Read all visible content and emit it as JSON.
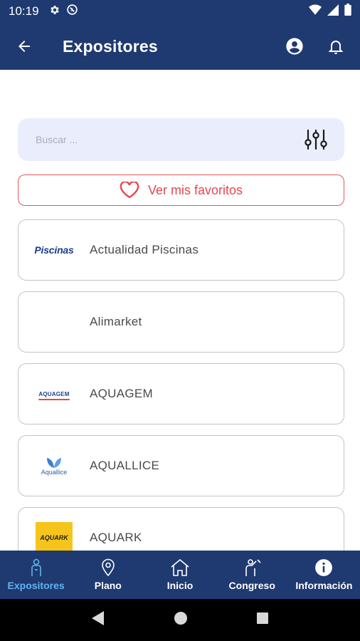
{
  "status_bar": {
    "time": "10:19",
    "left_icons": [
      "settings-icon",
      "no-sim-icon"
    ],
    "right_icons": [
      "wifi-icon",
      "signal-icon",
      "battery-icon"
    ]
  },
  "app_bar": {
    "title": "Expositores",
    "back_icon": "arrow-back-icon",
    "actions": [
      "account-icon",
      "notifications-icon"
    ]
  },
  "search": {
    "placeholder": "Buscar ...",
    "filter_icon": "tune-icon"
  },
  "favorites": {
    "label": "Ver mis favoritos",
    "icon": "heart-outline-icon"
  },
  "exhibitors": [
    {
      "name": "Actualidad Piscinas",
      "logo_text": "Piscinas"
    },
    {
      "name": "Alimarket",
      "logo_text": ""
    },
    {
      "name": "AQUAGEM",
      "logo_text": "AQUAGEM"
    },
    {
      "name": "AQUALLICE",
      "logo_text": "Aquallice"
    },
    {
      "name": "AQUARK",
      "logo_text": "AQUARK"
    }
  ],
  "bottom_nav": [
    {
      "label": "Expositores",
      "icon": "exhibitor-icon",
      "active": true
    },
    {
      "label": "Plano",
      "icon": "map-pin-icon",
      "active": false
    },
    {
      "label": "Inicio",
      "icon": "home-icon",
      "active": false
    },
    {
      "label": "Congreso",
      "icon": "presenter-icon",
      "active": false
    },
    {
      "label": "Información",
      "icon": "info-icon",
      "active": false
    }
  ],
  "colors": {
    "primary": "#1f3a70",
    "accent_active": "#5fb4f0",
    "favorite": "#e5484d",
    "search_bg": "#eaeefc"
  }
}
